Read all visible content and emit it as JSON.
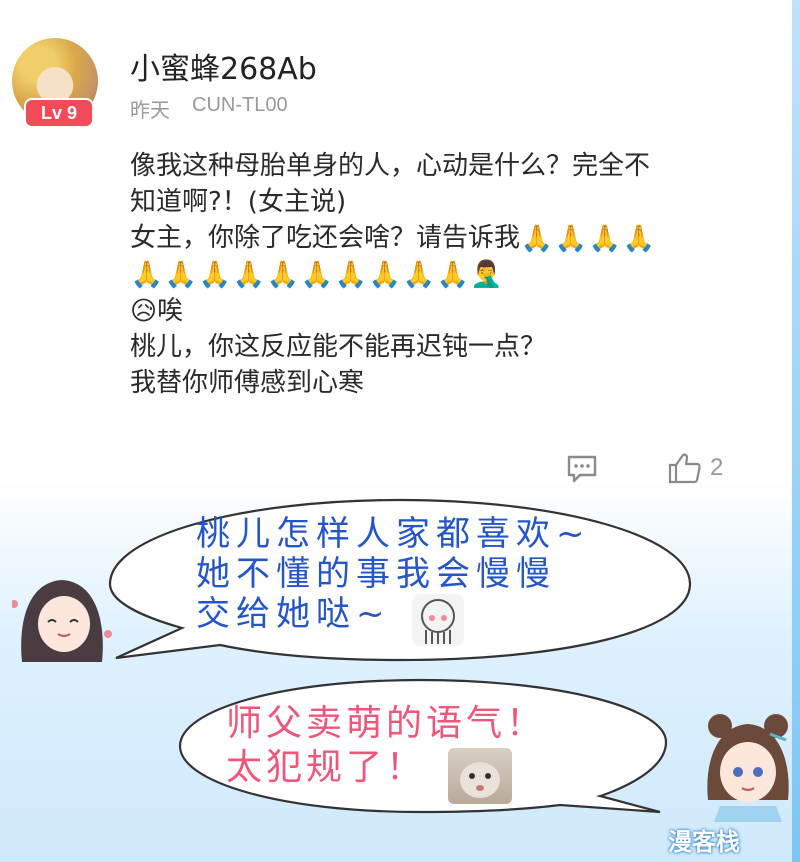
{
  "post": {
    "username": "小蜜蜂268Ab",
    "level": "Lv 9",
    "time": "昨天",
    "device": "CUN-TL00",
    "lines": [
      "像我这种母胎单身的人，心动是什么？完全不",
      "知道啊?！(女主说)",
      "女主，你除了吃还会啥？请告诉我",
      "",
      "唉",
      "桃儿，你这反应能不能再迟钝一点？",
      "我替你师傅感到心寒"
    ],
    "emojis": {
      "pray": "🙏",
      "facepalm": "🤦‍♂️",
      "sad": "😥"
    },
    "like_count": "2"
  },
  "bubbles": {
    "first_lines": [
      "桃儿怎样人家都喜欢~",
      "她不懂的事我会慢慢",
      "交给她哒~"
    ],
    "second_lines": [
      "师父卖萌的语气！",
      "太犯规了！"
    ]
  },
  "watermark": "漫客栈",
  "colors": {
    "badge": "#f24a57",
    "bubble_text_blue": "#2456c9",
    "bubble_text_pink": "#f0567a",
    "meta_gray": "#9a9a9a"
  }
}
